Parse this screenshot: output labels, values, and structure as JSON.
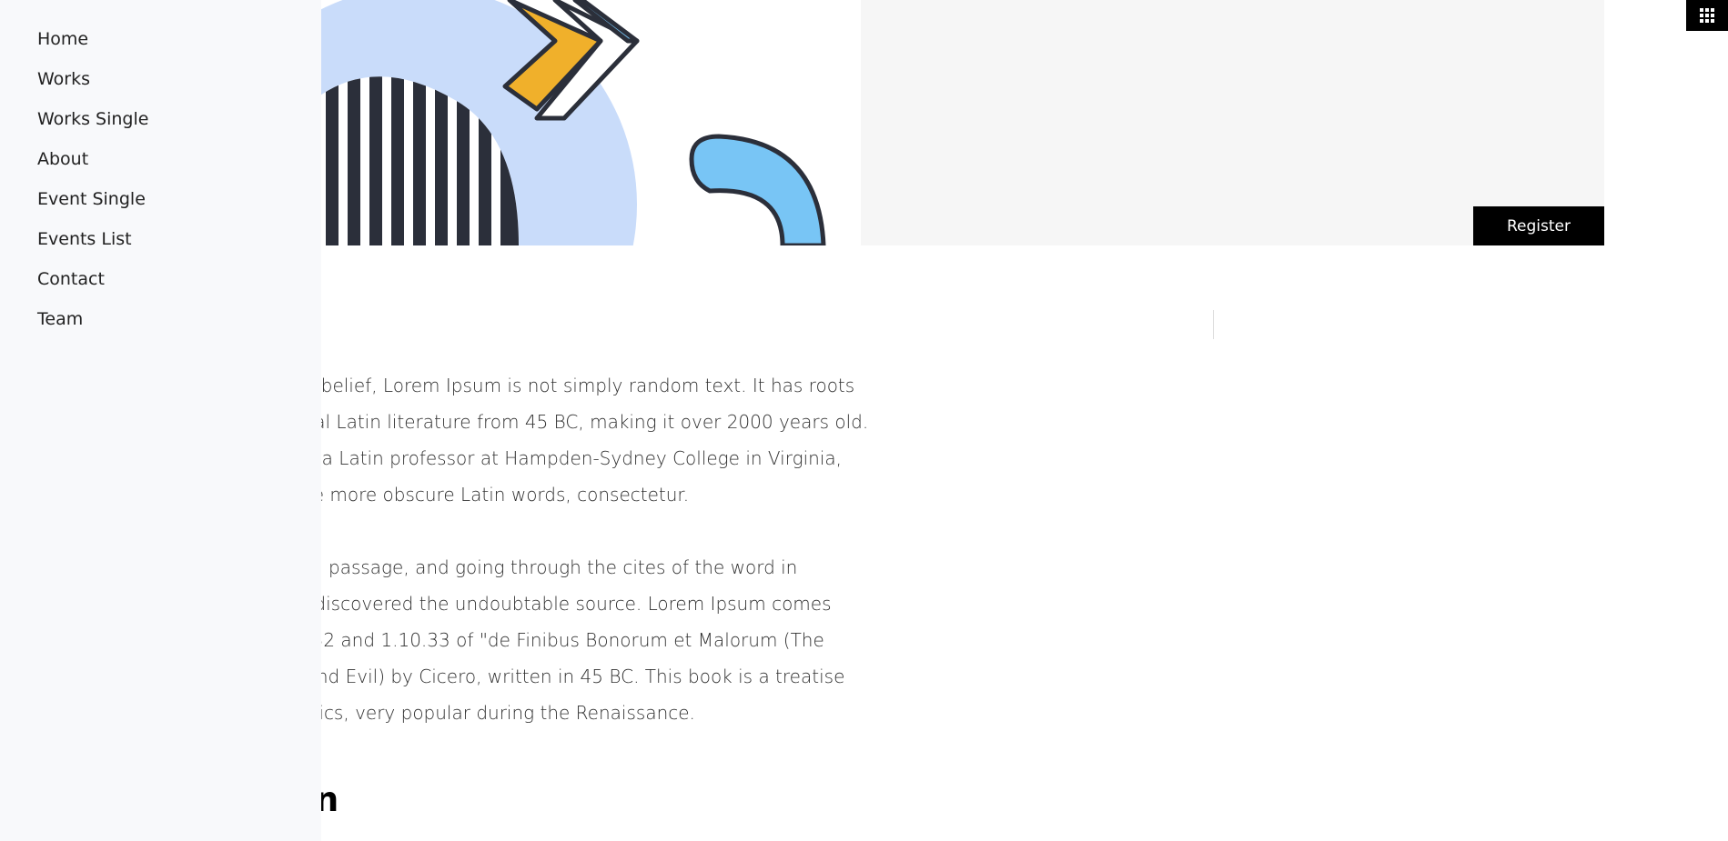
{
  "sidebar": {
    "items": [
      {
        "label": "Home"
      },
      {
        "label": "Works"
      },
      {
        "label": "Works Single"
      },
      {
        "label": "About"
      },
      {
        "label": "Event Single"
      },
      {
        "label": "Events List"
      },
      {
        "label": "Contact"
      },
      {
        "label": "Team"
      }
    ]
  },
  "hero": {
    "register_label": "Register"
  },
  "content": {
    "paragraphs": [
      "Contrary to popular belief, Lorem Ipsum is not simply random text. It has roots in a piece of classical Latin literature from 45 BC, making it over 2000 years old. Richard McClintock, a Latin professor at Hampden-Sydney College in Virginia, looked up one of the more obscure Latin words, consectetur.",
      "From a Lorem Ipsum passage, and going through the cites of the word in classical literature, discovered the undoubtable source. Lorem Ipsum comes from sections 1.10.32 and 1.10.33 of \"de Finibus Bonorum et Malorum (The Extremes of Good and Evil) by Cicero, written in 45 BC. This book is a treatise on the theory of ethics, very popular during the Renaissance."
    ],
    "heading": "Discussion"
  },
  "icons": {
    "menu": "grid-menu-icon"
  },
  "colors": {
    "accent_yellow": "#f0b02b",
    "accent_blue": "#78c5f5",
    "light_blue": "#c9dcfa",
    "dark_navy": "#2b2f3a",
    "button_black": "#000000",
    "sidebar_bg": "#f8f9fb",
    "panel_bg": "#f6f6f6"
  }
}
